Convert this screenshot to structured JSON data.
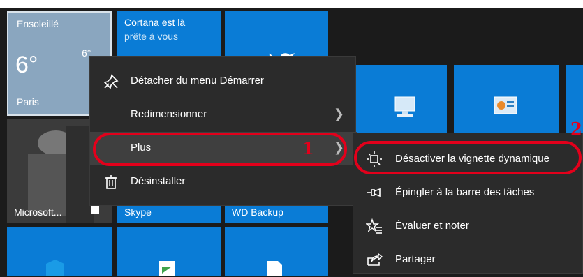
{
  "tiles": {
    "weather": {
      "condition": "Ensoleillé",
      "temp": "6°",
      "small_temp": "6°",
      "city": "Paris"
    },
    "cortana": {
      "line1": "Cortana est là",
      "line2": "prête à vous"
    },
    "movie": {
      "label": "Microsoft..."
    },
    "skype": {
      "label": "Skype"
    },
    "wd": {
      "label": "WD Backup"
    }
  },
  "context_menu": {
    "items": [
      {
        "label": "Détacher du menu Démarrer",
        "icon": "unpin-icon"
      },
      {
        "label": "Redimensionner",
        "icon": "",
        "submenu": true
      },
      {
        "label": "Plus",
        "icon": "",
        "submenu": true,
        "highlighted": true
      },
      {
        "label": "Désinstaller",
        "icon": "trash-icon"
      }
    ]
  },
  "submenu": {
    "items": [
      {
        "label": "Désactiver la vignette dynamique",
        "icon": "live-tile-icon"
      },
      {
        "label": "Épingler à la barre des tâches",
        "icon": "pin-taskbar-icon"
      },
      {
        "label": "Évaluer et noter",
        "icon": "rate-icon"
      },
      {
        "label": "Partager",
        "icon": "share-icon"
      }
    ]
  },
  "annotations": {
    "step1": "1",
    "step2": "2",
    "color": "#e3001b"
  }
}
